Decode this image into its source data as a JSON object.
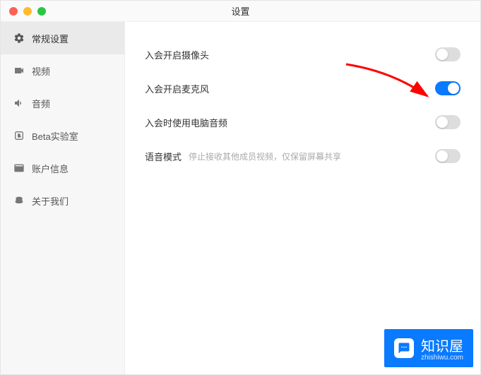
{
  "window": {
    "title": "设置"
  },
  "sidebar": {
    "items": [
      {
        "label": "常规设置"
      },
      {
        "label": "视频"
      },
      {
        "label": "音频"
      },
      {
        "label": "Beta实验室"
      },
      {
        "label": "账户信息"
      },
      {
        "label": "关于我们"
      }
    ]
  },
  "settings": {
    "camera": {
      "label": "入会开启摄像头"
    },
    "mic": {
      "label": "入会开启麦克风"
    },
    "pcaudio": {
      "label": "入会时使用电脑音频"
    },
    "voicemode": {
      "label": "语音模式",
      "desc": "停止接收其他成员视频，仅保留屏幕共享"
    }
  },
  "watermark": {
    "label": "知识屋",
    "url": "zhishiwu.com"
  }
}
